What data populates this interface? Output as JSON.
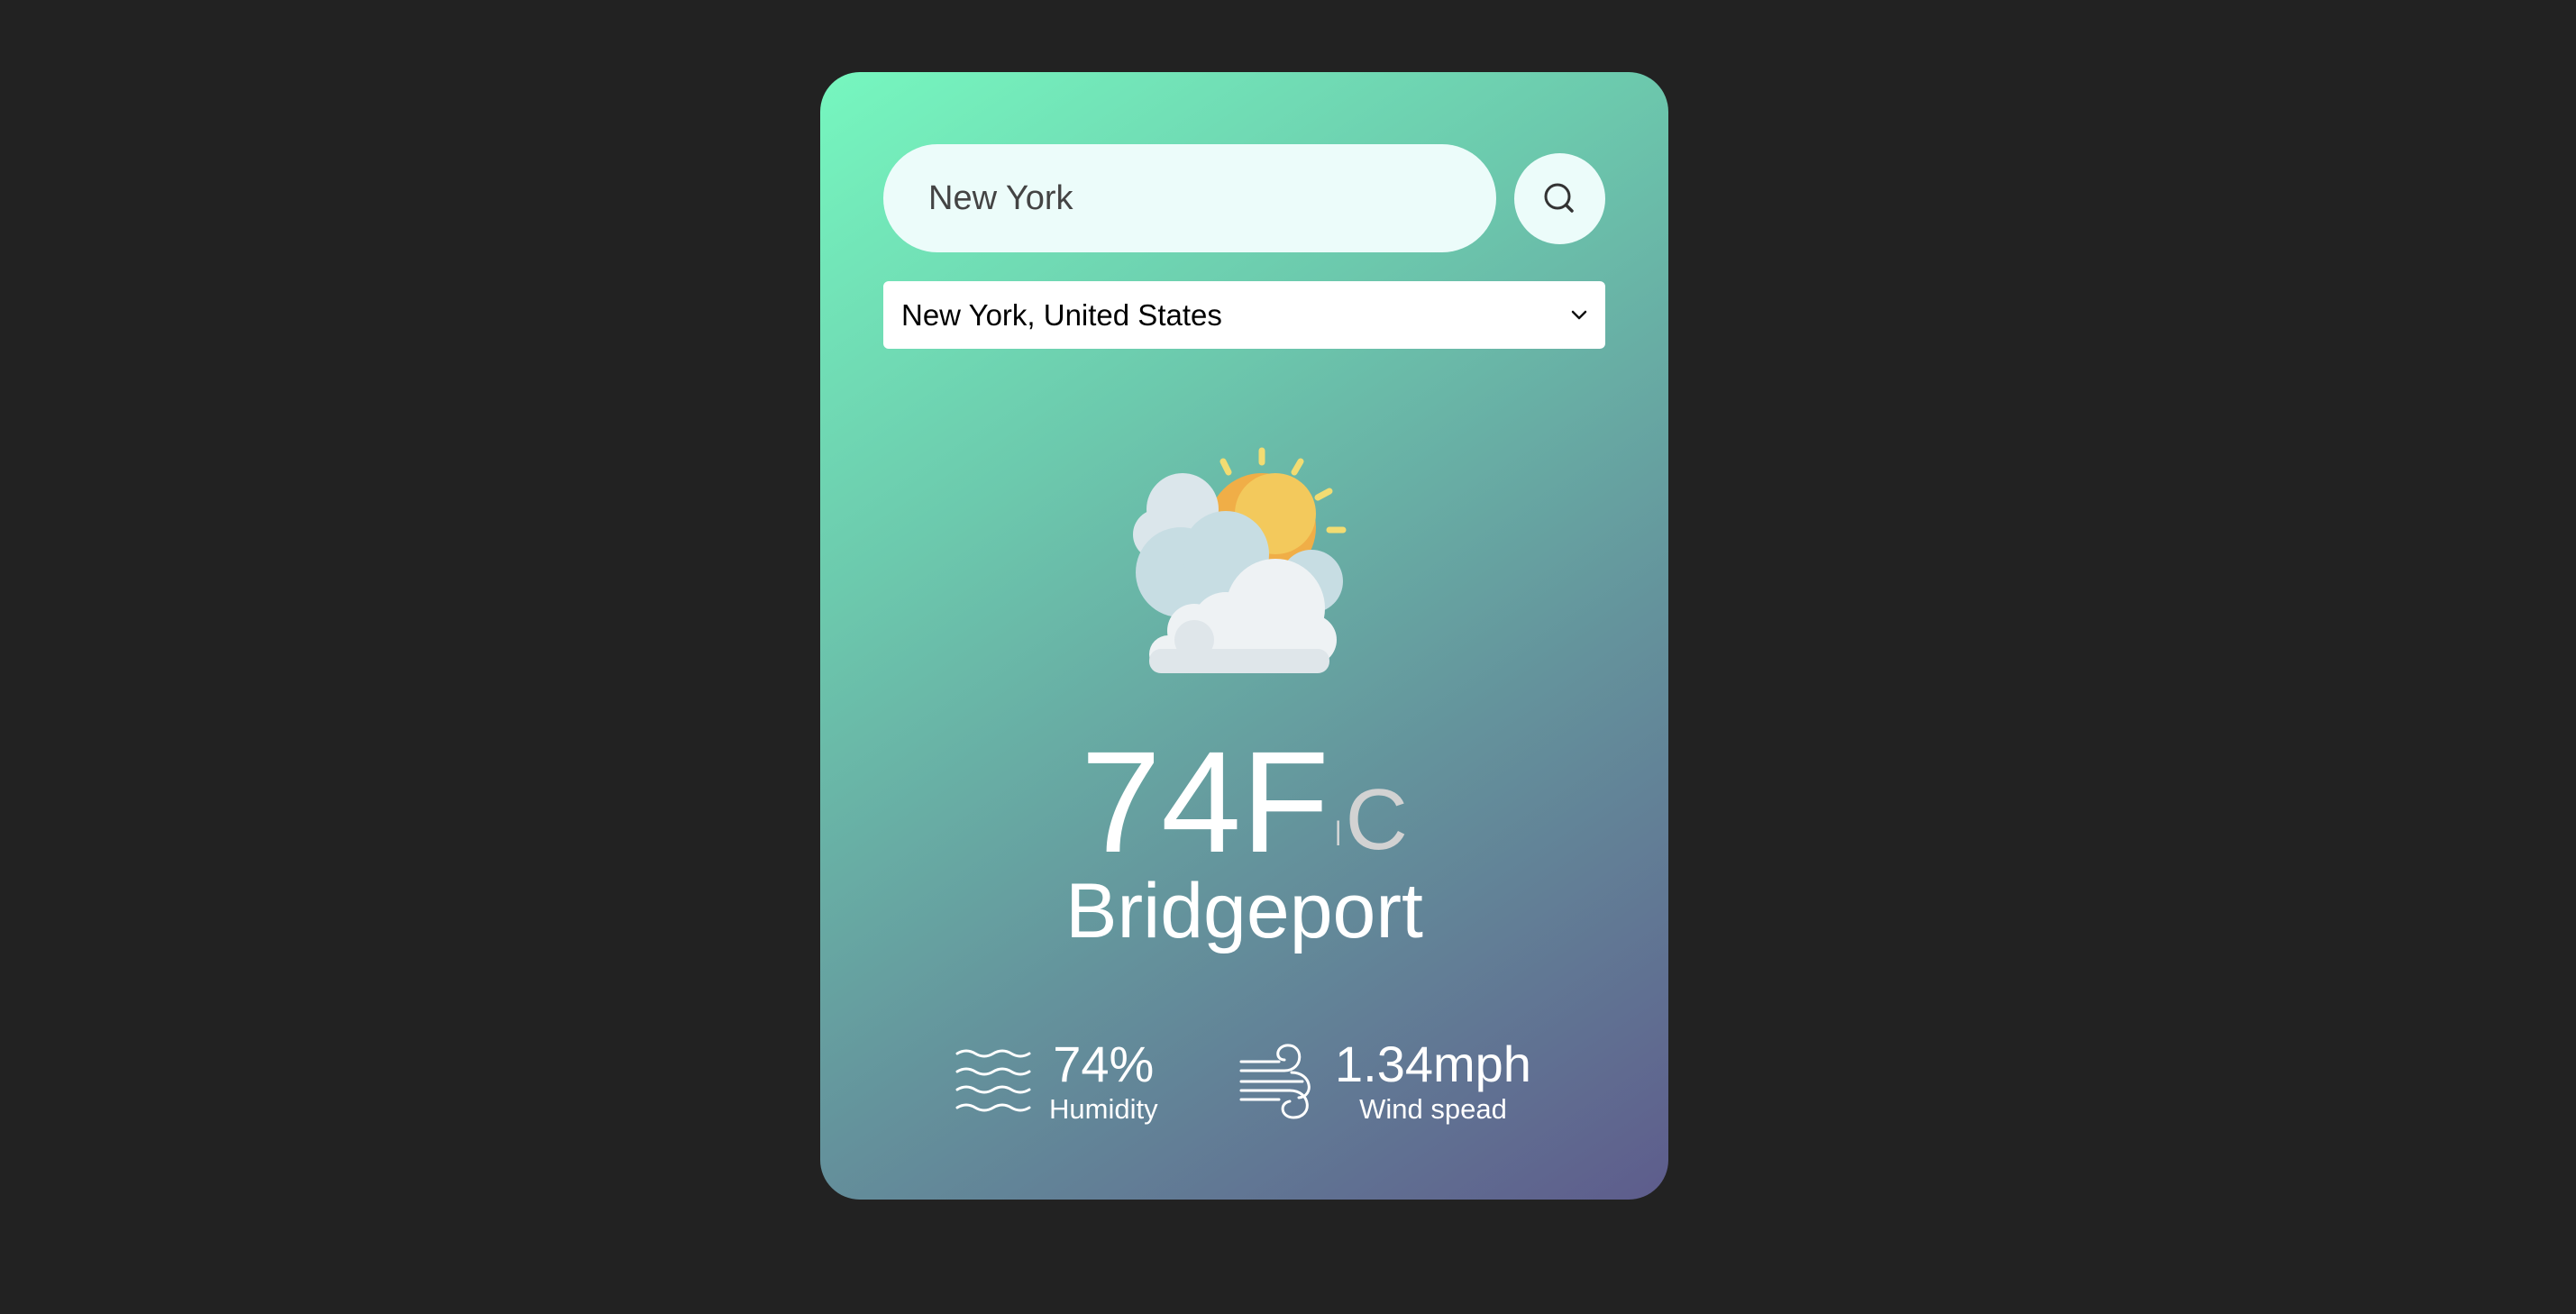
{
  "search": {
    "value": "New York",
    "icon": "search-icon"
  },
  "location_select": {
    "selected": "New York, United States",
    "icon": "chevron-down-icon"
  },
  "weather": {
    "icon": "partly-cloudy-icon",
    "temperature": "74F",
    "unit_separator": "|",
    "alt_unit": "C",
    "city": "Bridgeport"
  },
  "stats": {
    "humidity": {
      "value": "74%",
      "label": "Humidity",
      "icon": "waves-icon"
    },
    "wind": {
      "value": "1.34mph",
      "label": "Wind spead",
      "icon": "wind-icon"
    }
  },
  "colors": {
    "page_background": "#222222",
    "card_gradient_start": "#76f7bf",
    "card_gradient_end": "#5e5c8c",
    "input_background": "#ecfcfa"
  }
}
